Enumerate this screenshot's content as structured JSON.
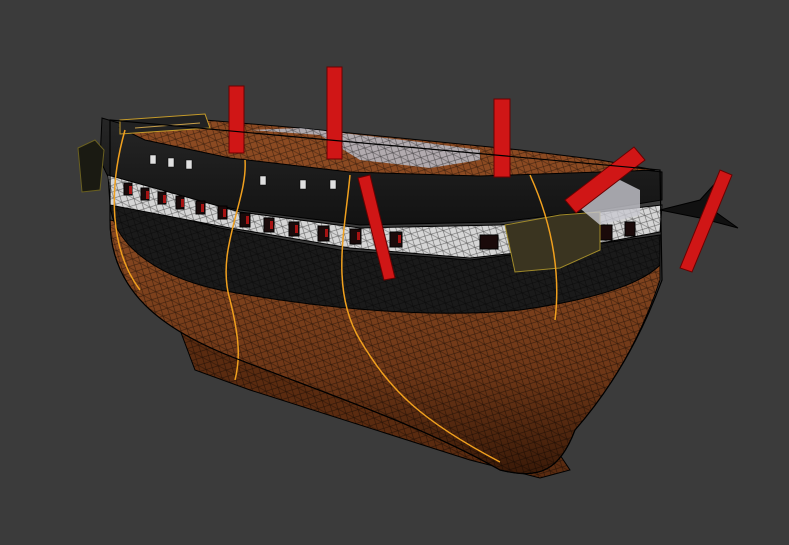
{
  "viewport": {
    "background_color": "#3b3b3b",
    "mode": "wireframe-over-textured",
    "model": "sailing-ship-hull"
  },
  "colors": {
    "hull_lower": "#7a3f1c",
    "hull_lower_dark": "#3e1e0c",
    "hull_upper": "#1c1c1c",
    "gunport_band": "#d7d7d7",
    "mast_stub": "#d41717",
    "seam_highlight": "#f0a01e",
    "wire": "#000000",
    "deck": "#8a4a25"
  },
  "icons": {
    "ship": "ship-model"
  }
}
